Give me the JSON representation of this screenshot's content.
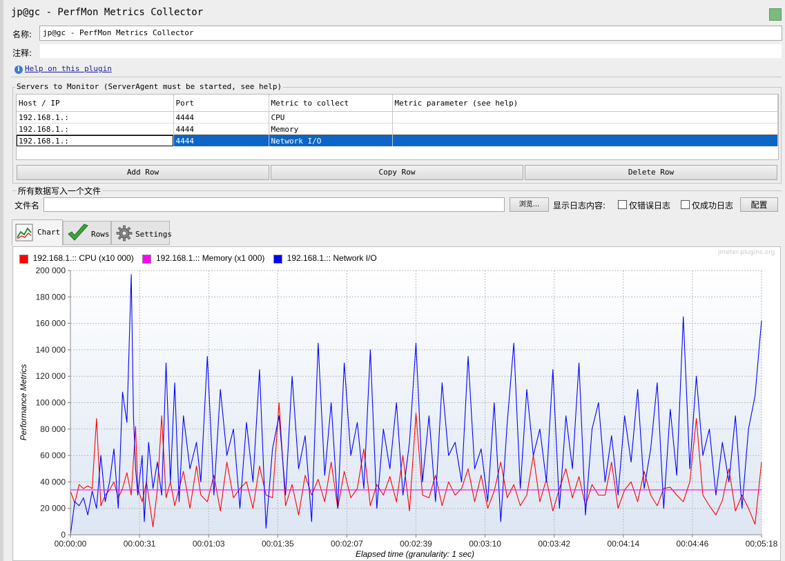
{
  "window": {
    "title": "jp@gc - PerfMon Metrics Collector"
  },
  "form": {
    "name_label": "名称:",
    "name_value": "jp@gc - PerfMon Metrics Collector",
    "comment_label": "注释:",
    "comment_value": "",
    "help_link": "Help on this plugin",
    "help_icon_glyph": "i"
  },
  "servers": {
    "group_title": "Servers to Monitor (ServerAgent must be started, see help)",
    "columns": [
      "Host / IP",
      "Port",
      "Metric to collect",
      "Metric parameter (see help)"
    ],
    "rows": [
      {
        "host": "192.168.1.:",
        "port": "4444",
        "metric": "CPU",
        "param": ""
      },
      {
        "host": "192.168.1.:",
        "port": "4444",
        "metric": "Memory",
        "param": ""
      },
      {
        "host": "192.168.1.:",
        "port": "4444",
        "metric": "Network I/O",
        "param": ""
      }
    ],
    "selected_row": 2,
    "add_row": "Add Row",
    "copy_row": "Copy Row",
    "delete_row": "Delete Row"
  },
  "file_section": {
    "group_title": "所有数据写入一个文件",
    "file_label": "文件名",
    "file_value": "",
    "browse_button": "浏览...",
    "log_display_label": "显示日志内容:",
    "errors_only_label": "仅错误日志",
    "errors_only_checked": false,
    "success_only_label": "仅成功日志",
    "success_only_checked": false,
    "configure_button": "配置"
  },
  "tabs": [
    {
      "label": "Chart",
      "icon": "chart-icon",
      "active": true
    },
    {
      "label": "Rows",
      "icon": "checkmark-icon",
      "active": false
    },
    {
      "label": "Settings",
      "icon": "gear-icon",
      "active": false
    }
  ],
  "chart_data": {
    "type": "line",
    "watermark": "jmeter-plugins.org",
    "xlabel": "Elapsed time (granularity: 1 sec)",
    "ylabel": "Performance Metrics",
    "ylim": [
      0,
      200000
    ],
    "y_ticks": [
      "0",
      "20 000",
      "40 000",
      "60 000",
      "80 000",
      "100 000",
      "120 000",
      "140 000",
      "160 000",
      "180 000",
      "200 000"
    ],
    "x_ticks": [
      "00:00:00",
      "00:00:31",
      "00:01:03",
      "00:01:35",
      "00:02:07",
      "00:02:39",
      "00:03:10",
      "00:03:42",
      "00:04:14",
      "00:04:46",
      "00:05:18"
    ],
    "x_range_sec": [
      0,
      318
    ],
    "grid": true,
    "legend_position": "top-left",
    "series": [
      {
        "name": "192.168.1.:: CPU (x10 000)",
        "color": "#ff0000",
        "t": [
          0,
          2,
          4,
          6,
          8,
          10,
          12,
          14,
          16,
          18,
          20,
          22,
          24,
          26,
          28,
          30,
          31,
          33,
          35,
          38,
          40,
          42,
          44,
          46,
          48,
          50,
          52,
          55,
          58,
          60,
          63,
          66,
          69,
          72,
          75,
          78,
          81,
          84,
          87,
          90,
          93,
          96,
          99,
          102,
          105,
          108,
          111,
          114,
          117,
          120,
          123,
          126,
          129,
          132,
          135,
          138,
          141,
          144,
          147,
          150,
          153,
          156,
          159,
          162,
          165,
          168,
          171,
          174,
          177,
          180,
          183,
          186,
          189,
          192,
          195,
          198,
          201,
          204,
          207,
          210,
          213,
          216,
          219,
          222,
          225,
          228,
          231,
          234,
          237,
          240,
          243,
          246,
          249,
          252,
          255,
          258,
          261,
          264,
          267,
          270,
          273,
          276,
          279,
          282,
          285,
          288,
          291,
          294,
          297,
          300,
          303,
          306,
          309,
          312,
          315,
          318
        ],
        "values": [
          33000,
          24000,
          38000,
          35000,
          37000,
          35000,
          88000,
          22000,
          30000,
          34000,
          40000,
          28000,
          35000,
          47000,
          30000,
          82000,
          35000,
          25000,
          40000,
          6000,
          34000,
          90000,
          28000,
          40000,
          22000,
          35000,
          48000,
          20000,
          52000,
          30000,
          25000,
          45000,
          18000,
          55000,
          28000,
          35000,
          40000,
          20000,
          52000,
          30000,
          28000,
          100000,
          22000,
          38000,
          15000,
          45000,
          30000,
          42000,
          25000,
          55000,
          20000,
          48000,
          28000,
          35000,
          65000,
          22000,
          38000,
          30000,
          44000,
          25000,
          60000,
          18000,
          92000,
          30000,
          28000,
          45000,
          22000,
          40000,
          30000,
          35000,
          50000,
          25000,
          45000,
          20000,
          33000,
          55000,
          28000,
          38000,
          22000,
          30000,
          60000,
          25000,
          42000,
          18000,
          35000,
          50000,
          28000,
          44000,
          22000,
          38000,
          30000,
          30000,
          55000,
          20000,
          34000,
          40000,
          25000,
          48000,
          30000,
          22000,
          35000,
          36000,
          30000,
          25000,
          40000,
          88000,
          30000,
          22000,
          15000,
          26000,
          50000,
          18000,
          30000,
          20000,
          8000,
          55000
        ]
      },
      {
        "name": "192.168.1.:: Memory (x1 000)",
        "color": "#ff00ff",
        "t": [
          0,
          318
        ],
        "values": [
          34000,
          34000
        ]
      },
      {
        "name": "192.168.1.:: Network I/O",
        "color": "#0000ff",
        "t": [
          0,
          2,
          4,
          6,
          8,
          10,
          12,
          14,
          16,
          18,
          20,
          22,
          24,
          26,
          28,
          29,
          30,
          31,
          33,
          34,
          36,
          38,
          40,
          42,
          44,
          46,
          48,
          50,
          52,
          55,
          58,
          60,
          63,
          66,
          69,
          72,
          75,
          78,
          81,
          84,
          87,
          90,
          93,
          96,
          99,
          102,
          105,
          108,
          111,
          114,
          117,
          120,
          123,
          126,
          129,
          132,
          135,
          138,
          141,
          144,
          147,
          150,
          153,
          156,
          159,
          162,
          165,
          168,
          171,
          174,
          177,
          180,
          183,
          186,
          189,
          192,
          195,
          198,
          201,
          204,
          207,
          210,
          213,
          216,
          219,
          222,
          225,
          228,
          231,
          234,
          237,
          240,
          243,
          246,
          249,
          252,
          255,
          258,
          261,
          264,
          267,
          270,
          273,
          276,
          279,
          282,
          285,
          288,
          291,
          294,
          297,
          300,
          303,
          306,
          309,
          312,
          315,
          318
        ],
        "values": [
          0,
          25000,
          22000,
          28000,
          15000,
          33000,
          20000,
          60000,
          25000,
          40000,
          65000,
          20000,
          108000,
          85000,
          197000,
          90000,
          50000,
          30000,
          60000,
          10000,
          70000,
          35000,
          55000,
          30000,
          130000,
          40000,
          115000,
          25000,
          90000,
          50000,
          70000,
          40000,
          135000,
          30000,
          110000,
          60000,
          80000,
          20000,
          85000,
          40000,
          125000,
          5000,
          65000,
          90000,
          30000,
          120000,
          50000,
          75000,
          10000,
          145000,
          45000,
          100000,
          20000,
          130000,
          60000,
          85000,
          35000,
          140000,
          20000,
          80000,
          50000,
          100000,
          30000,
          70000,
          145000,
          40000,
          90000,
          25000,
          115000,
          60000,
          70000,
          40000,
          135000,
          50000,
          65000,
          25000,
          100000,
          10000,
          85000,
          145000,
          35000,
          110000,
          60000,
          80000,
          40000,
          125000,
          20000,
          90000,
          50000,
          130000,
          15000,
          80000,
          100000,
          40000,
          75000,
          30000,
          90000,
          55000,
          110000,
          35000,
          65000,
          115000,
          20000,
          95000,
          45000,
          165000,
          50000,
          120000,
          60000,
          80000,
          30000,
          70000,
          40000,
          90000,
          20000,
          80000,
          105000,
          162000
        ]
      }
    ]
  }
}
